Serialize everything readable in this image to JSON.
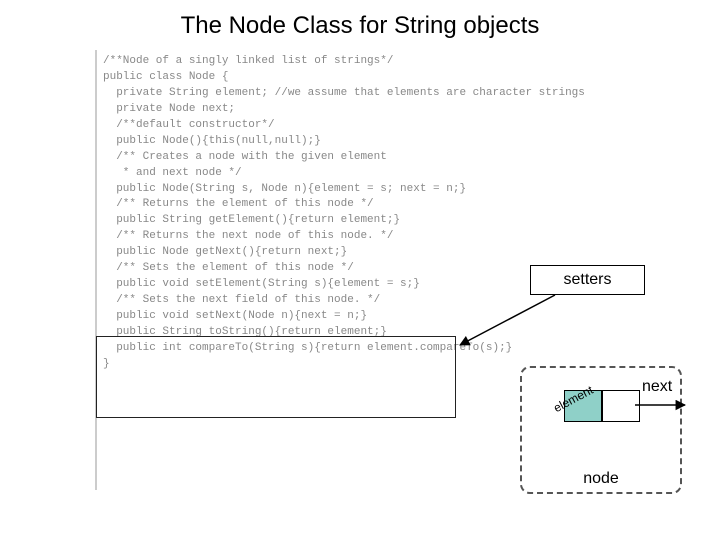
{
  "title": "The Node Class for String objects",
  "labels": {
    "setters": "setters",
    "node": "node",
    "element": "element",
    "next": "next"
  },
  "code": {
    "l00": "/**Node of a singly linked list of strings*/",
    "l01": "public class Node {",
    "l02": "",
    "l03": "  private String element; //we assume that elements are character strings",
    "l04": "  private Node next;",
    "l05": "",
    "l06": "  /**default constructor*/",
    "l07": "  public Node(){this(null,null);}",
    "l08": "",
    "l09": "  /** Creates a node with the given element",
    "l10": "   * and next node */",
    "l11": "  public Node(String s, Node n){element = s; next = n;}",
    "l12": "",
    "l13": "  /** Returns the element of this node */",
    "l14": "  public String getElement(){return element;}",
    "l15": "",
    "l16": "  /** Returns the next node of this node. */",
    "l17": "  public Node getNext(){return next;}",
    "l18": "",
    "l19": "  /** Sets the element of this node */",
    "l20": "  public void setElement(String s){element = s;}",
    "l21": "",
    "l22": "  /** Sets the next field of this node. */",
    "l23": "  public void setNext(Node n){next = n;}",
    "l24": "",
    "l25": "  public String toString(){return element;}",
    "l26": "",
    "l27": "  public int compareTo(String s){return element.compareTo(s);}",
    "l28": "}"
  }
}
